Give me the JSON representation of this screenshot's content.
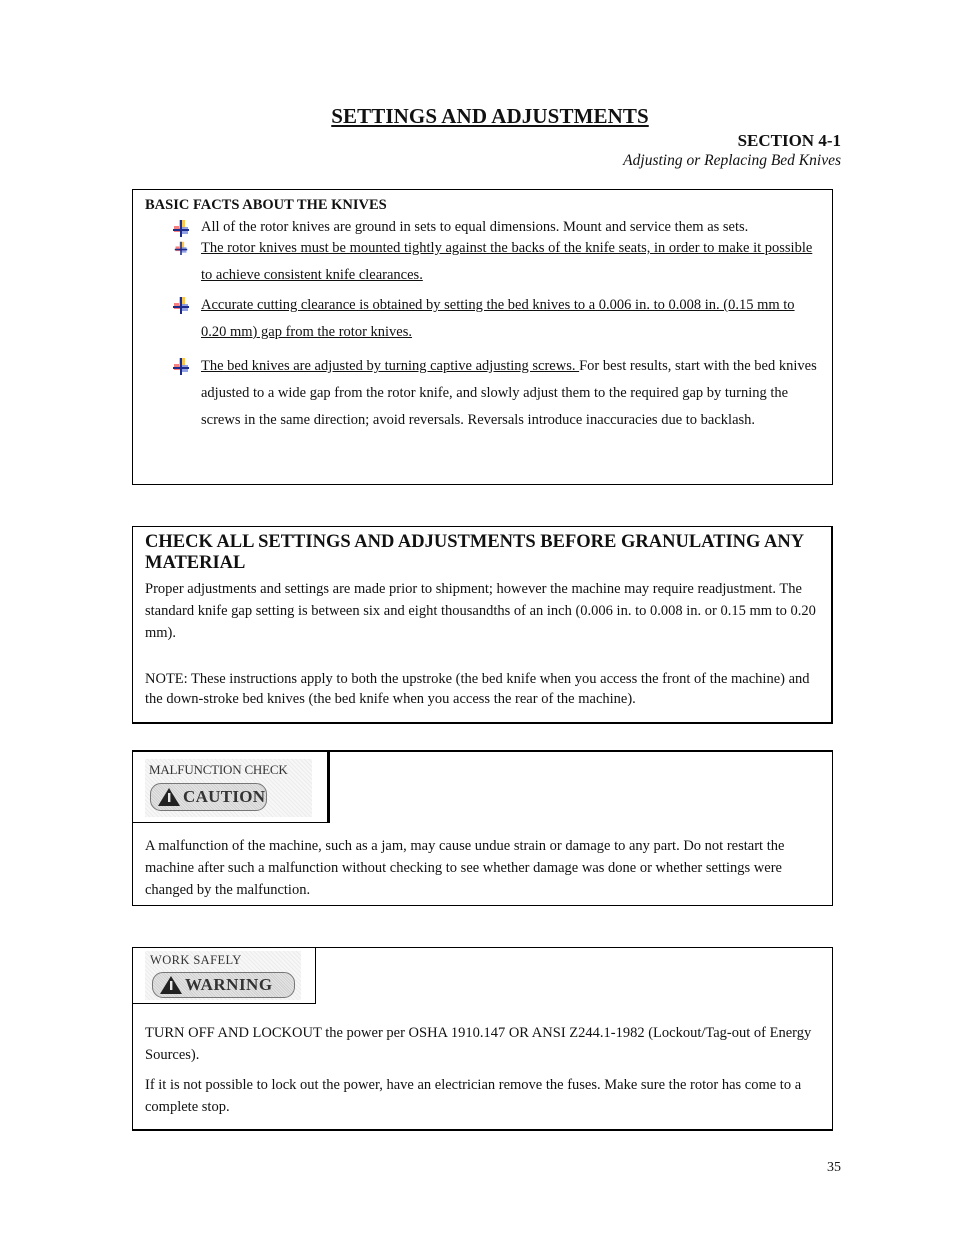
{
  "header": {
    "title": "SETTINGS AND ADJUSTMENTS",
    "section_number": "SECTION 4-1",
    "section_subtitle": "Adjusting or Replacing Bed Knives"
  },
  "basic_facts": {
    "heading": "BASIC FACTS ABOUT THE KNIVES",
    "bullet_icon": "pushpin-icon",
    "items": [
      {
        "underlined": "",
        "text": "All of the rotor knives are ground in sets to equal dimensions. Mount and service them as sets."
      },
      {
        "underlined": "The rotor knives must be mounted tightly against the backs of the knife seats, in order to make it possible to achieve consistent knife clearances.",
        "text": ""
      },
      {
        "underlined": "Accurate cutting clearance is obtained by setting the bed knives to a 0.006 in. to 0.008 in. (0.15 mm to 0.20 mm) gap from the rotor knives.",
        "text": ""
      },
      {
        "underlined": "The bed knives are adjusted by turning captive adjusting screws. ",
        "text": "For best results, start with the bed knives adjusted to a wide gap from the rotor knife, and slowly adjust them to the required gap by turning the screws in the same direction; avoid reversals. Reversals introduce inaccuracies due to backlash."
      }
    ]
  },
  "check_settings": {
    "heading": "CHECK ALL SETTINGS AND ADJUSTMENTS BEFORE GRANULATING ANY MATERIAL",
    "paragraph": "Proper adjustments and settings are made prior to shipment; however the machine may require readjustment. The standard knife gap setting is between six and eight thousandths of an inch (0.006 in. to 0.008 in. or 0.15 mm to 0.20 mm).",
    "note": "NOTE: These instructions apply to both the upstroke (the bed knife when you access the front of the machine) and the down-stroke bed knives (the bed knife when you access the rear of the machine)."
  },
  "caution": {
    "caption": "MALFUNCTION CHECK",
    "signal_word": "CAUTION",
    "icon": "warning-triangle-icon",
    "text": "A malfunction of the machine, such as a jam, may cause undue strain or damage to any part. Do not restart the machine after such a malfunction without checking to see whether damage was done or whether settings were changed by the malfunction."
  },
  "warning": {
    "caption": "WORK SAFELY",
    "signal_word": "WARNING",
    "icon": "warning-triangle-icon",
    "paragraphs": [
      "TURN OFF AND LOCKOUT the power per OSHA 1910.147 OR ANSI Z244.1-1982 (Lockout/Tag-out of Energy Sources).",
      "If it is not possible to lock out the power, have an electrician remove the fuses. Make sure the rotor has come to a complete stop."
    ]
  },
  "footer": {
    "page_number": "35"
  }
}
